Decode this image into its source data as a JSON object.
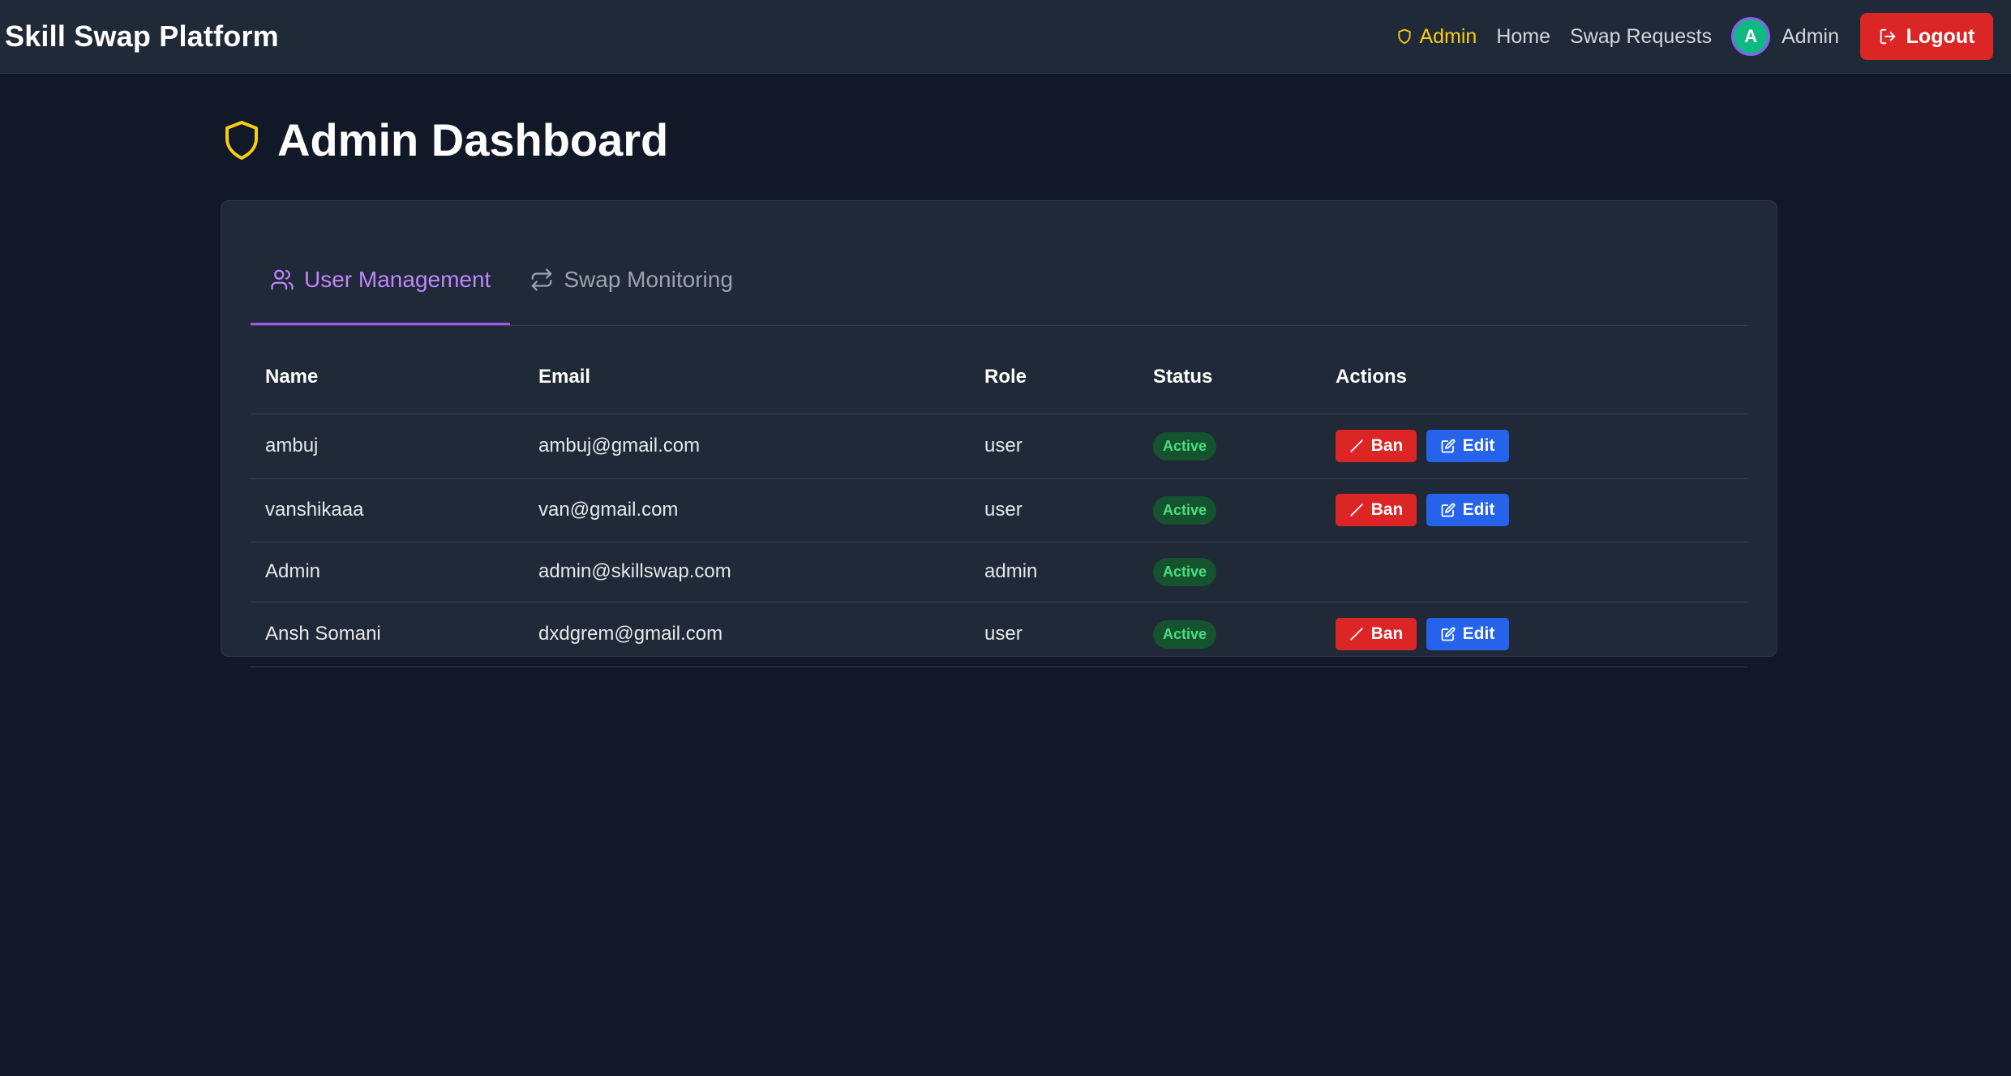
{
  "colors": {
    "background": "#111827",
    "navbar": "#1f2937",
    "accent_admin": "#facc15",
    "accent_tab": "#c084fc",
    "danger": "#dc2626",
    "primary": "#2563eb",
    "success_text": "#4ade80"
  },
  "navbar": {
    "brand": "Skill Swap Platform",
    "admin_link": {
      "label": "Admin",
      "icon": "shield-icon"
    },
    "links": [
      {
        "label": "Home"
      },
      {
        "label": "Swap Requests"
      }
    ],
    "user": {
      "avatar_initial": "A",
      "name": "Admin"
    },
    "logout": {
      "label": "Logout",
      "icon": "logout-icon"
    }
  },
  "page": {
    "title": "Admin Dashboard",
    "title_icon": "shield-icon"
  },
  "tabs": [
    {
      "label": "User Management",
      "icon": "users-icon",
      "active": true
    },
    {
      "label": "Swap Monitoring",
      "icon": "swap-arrows-icon",
      "active": false
    }
  ],
  "table": {
    "columns": [
      "Name",
      "Email",
      "Role",
      "Status",
      "Actions"
    ],
    "rows": [
      {
        "name": "ambuj",
        "email": "ambuj@gmail.com",
        "role": "user",
        "status": "Active",
        "actions": [
          "Ban",
          "Edit"
        ]
      },
      {
        "name": "vanshikaaa",
        "email": "van@gmail.com",
        "role": "user",
        "status": "Active",
        "actions": [
          "Ban",
          "Edit"
        ]
      },
      {
        "name": "Admin",
        "email": "admin@skillswap.com",
        "role": "admin",
        "status": "Active",
        "actions": []
      },
      {
        "name": "Ansh Somani",
        "email": "dxdgrem@gmail.com",
        "role": "user",
        "status": "Active",
        "actions": [
          "Ban",
          "Edit"
        ]
      }
    ]
  }
}
